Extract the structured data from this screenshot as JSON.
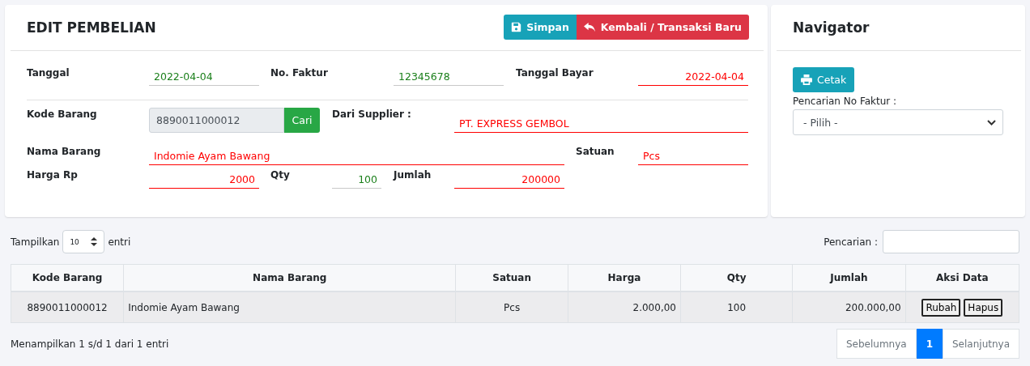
{
  "main_card": {
    "title": "EDIT PEMBELIAN",
    "buttons": [
      {
        "kind": "save",
        "label": "Simpan"
      },
      {
        "kind": "back",
        "label": "Kembali / Transaksi Baru"
      }
    ]
  },
  "form": {
    "tanggal": {
      "label": "Tanggal",
      "value": "2022-04-04",
      "color": "#1a7f1a"
    },
    "no_faktur": {
      "label": "No. Faktur",
      "value": "12345678",
      "color": "#1a7f1a"
    },
    "tanggal_bayar": {
      "label": "Tanggal Bayar",
      "value": "2022-04-04",
      "color": "#ff0000"
    },
    "kode_barang": {
      "label": "Kode Barang",
      "value": "8890011000012",
      "button": "Cari"
    },
    "supplier": {
      "label": "Dari Supplier :",
      "value": "PT. EXPRESS GEMBOL",
      "color": "#ff0000"
    },
    "nama_barang": {
      "label": "Nama Barang",
      "value": "Indomie Ayam Bawang",
      "color": "#ff0000"
    },
    "satuan": {
      "label": "Satuan",
      "value": "Pcs",
      "color": "#ff0000"
    },
    "harga": {
      "label": "Harga Rp",
      "value": "2000",
      "color": "#ff0000"
    },
    "qty": {
      "label": "Qty",
      "value": "100",
      "color": "#1a7f1a"
    },
    "jumlah": {
      "label": "Jumlah",
      "value": "200000",
      "color": "#ff0000"
    }
  },
  "navigator": {
    "title": "Navigator",
    "print_button": "Cetak",
    "search_label": "Pencarian No Faktur :",
    "search_value": "- Pilih -"
  },
  "table_controls": {
    "show_label": "Tampilkan",
    "page_size": "10",
    "entries_label": "entri",
    "search_label": "Pencarian :"
  },
  "table": {
    "columns": [
      "Kode Barang",
      "Nama Barang",
      "Satuan",
      "Harga",
      "Qty",
      "Jumlah",
      "Aksi Data"
    ],
    "rows": [
      {
        "cells": [
          "8890011000012",
          "Indomie Ayam Bawang",
          "Pcs",
          "2.000,00",
          "100",
          "200.000,00"
        ],
        "actions": [
          "Rubah",
          "Hapus"
        ]
      }
    ]
  },
  "footer": {
    "info": "Menampilkan 1 s/d 1 dari 1 entri",
    "pagination": [
      {
        "label": "Sebelumnya",
        "selected": false
      },
      {
        "label": "1",
        "selected": true
      },
      {
        "label": "Selanjutnya",
        "selected": false
      }
    ]
  }
}
